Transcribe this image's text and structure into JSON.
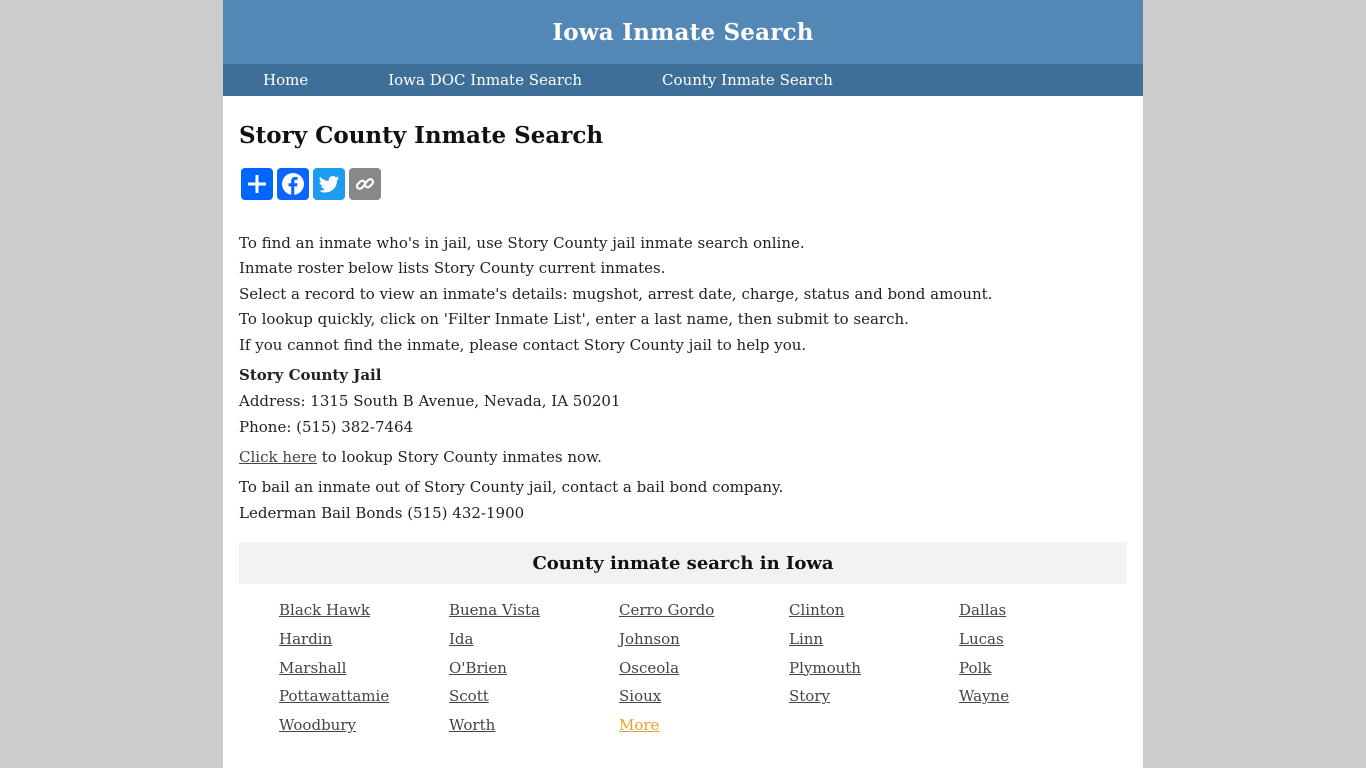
{
  "header": {
    "title": "Iowa Inmate Search"
  },
  "nav": {
    "items": [
      {
        "label": "Home"
      },
      {
        "label": "Iowa DOC Inmate Search"
      },
      {
        "label": "County Inmate Search"
      }
    ]
  },
  "main": {
    "title": "Story County Inmate Search",
    "share": [
      {
        "icon": "share-plus-icon",
        "color": "#0166ff"
      },
      {
        "icon": "facebook-icon",
        "color": "#0866ff"
      },
      {
        "icon": "twitter-icon",
        "color": "#1d9bf0"
      },
      {
        "icon": "copy-link-icon",
        "color": "#888888"
      }
    ],
    "intro": [
      "To find an inmate who's in jail, use Story County jail inmate search online.",
      "Inmate roster below lists Story County current inmates.",
      "Select a record to view an inmate's details: mugshot, arrest date, charge, status and bond amount.",
      "To lookup quickly, click on 'Filter Inmate List', enter a last name, then submit to search.",
      "If you cannot find the inmate, please contact Story County jail to help you."
    ],
    "jail": {
      "name": "Story County Jail",
      "address": "Address: 1315 South B Avenue, Nevada, IA 50201",
      "phone": "Phone: (515) 382-7464"
    },
    "lookup": {
      "link": "Click here",
      "text": " to lookup Story County inmates now."
    },
    "bail": {
      "text": "To bail an inmate out of Story County jail, contact a bail bond company.",
      "company": "Lederman Bail Bonds (515) 432-1900"
    }
  },
  "counties": {
    "title": "County inmate search in Iowa",
    "items": [
      "Black Hawk",
      "Buena Vista",
      "Cerro Gordo",
      "Clinton",
      "Dallas",
      "Hardin",
      "Ida",
      "Johnson",
      "Linn",
      "Lucas",
      "Marshall",
      "O'Brien",
      "Osceola",
      "Plymouth",
      "Polk",
      "Pottawattamie",
      "Scott",
      "Sioux",
      "Story",
      "Wayne",
      "Woodbury",
      "Worth",
      "More"
    ]
  }
}
